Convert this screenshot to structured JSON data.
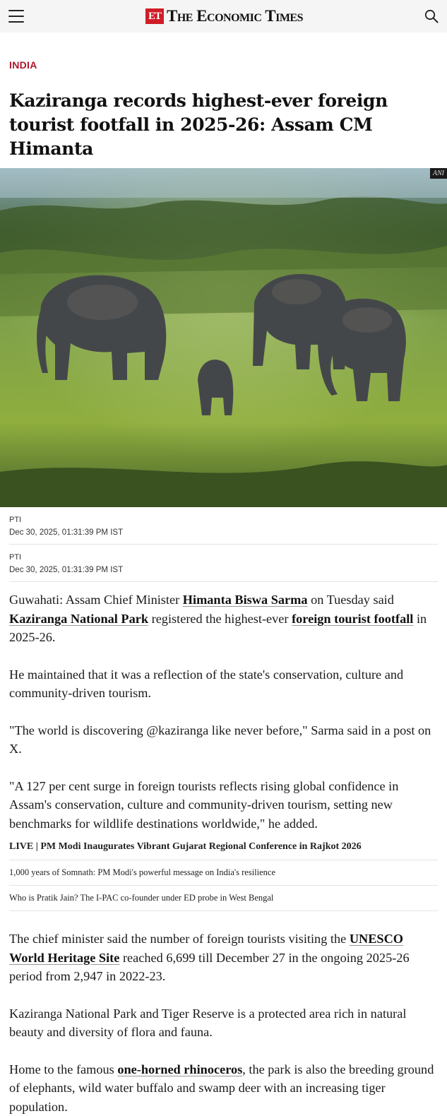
{
  "header": {
    "logo_badge": "ET",
    "logo_name": "The Economic Times",
    "menu_icon": "hamburger-menu-icon",
    "search_icon": "search-icon"
  },
  "article": {
    "section": "INDIA",
    "headline": "Kaziranga records highest-ever foreign tourist footfall in 2025-26: Assam CM Himanta",
    "image_credit": "ANI",
    "bylines": [
      {
        "agency": "PTI",
        "date": "Dec 30, 2025, 01:31:39 PM IST"
      },
      {
        "agency": "PTI",
        "date": "Dec 30, 2025, 01:31:39 PM IST"
      }
    ],
    "p1": {
      "t1": "Guwahati: Assam Chief Minister ",
      "link1": "Himanta Biswa Sarma",
      "t2": " on Tuesday said ",
      "link2": "Kaziranga National Park",
      "t3": " registered the highest-ever ",
      "link3": "foreign tourist footfall",
      "t4": " in 2025-26."
    },
    "p2": "He maintained that it was a reflection of the state's conservation, culture and community-driven tourism.",
    "p3": "\"The world is discovering @kaziranga like never before,\" Sarma said in a post on X.",
    "p4": "\"A 127 per cent surge in foreign tourists reflects rising global confidence in Assam's conservation, culture and community-driven tourism, setting new benchmarks for wildlife destinations worldwide,\" he added.",
    "related": [
      "LIVE | PM Modi Inaugurates Vibrant Gujarat Regional Conference in Rajkot 2026",
      "1,000 years of Somnath: PM Modi's powerful message on India's resilience",
      "Who is Pratik Jain? The I-PAC co-founder under ED probe in West Bengal"
    ],
    "p5": {
      "t1": "The chief minister said the number of foreign tourists visiting the ",
      "link1": "UNESCO World Heritage Site",
      "t2": " reached 6,699 till December 27 in the ongoing 2025-26 period from 2,947 in 2022-23."
    },
    "p6": "Kaziranga National Park and Tiger Reserve is a protected area rich in natural beauty and diversity of flora and fauna.",
    "p7": {
      "t1": "Home to the famous ",
      "link1": "one-horned rhinoceros",
      "t2": ", the park is also the breeding ground of elephants, wild water buffalo and swamp deer with an increasing tiger population."
    }
  }
}
